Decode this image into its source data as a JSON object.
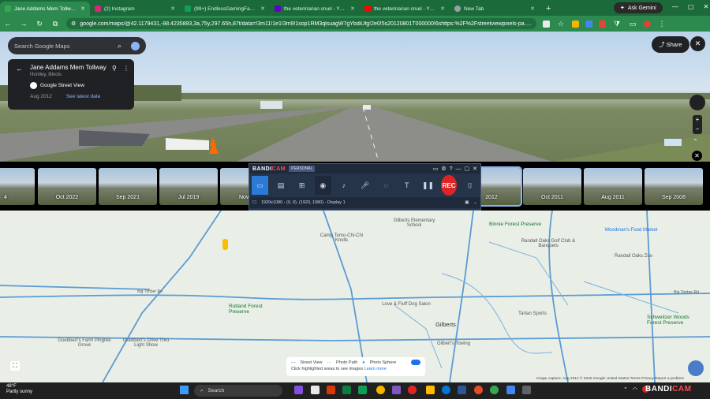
{
  "browser": {
    "tabs": [
      {
        "label": "Jane Addams Mem Tollway - G",
        "color": "#34a853",
        "active": true
      },
      {
        "label": "(2) Instagram",
        "color": "#d62976"
      },
      {
        "label": "(99+) EndlessGamingFanProdu",
        "color": "#0f9d58"
      },
      {
        "label": "the veterinarian cruel - Yahoo S",
        "color": "#6001d2"
      },
      {
        "label": "the veterinarian cruel - YouTub",
        "color": "#ff0000"
      },
      {
        "label": "New Tab",
        "color": "#9aa0a6"
      }
    ],
    "ask_gemini": "Ask Gemini",
    "url": "google.com/maps/@42.1179431,-88.4235893,3a,75y,297.65h,87t/data=!3m11!1e1!3m9!1sop1RM3qlsuagW7gYbdiUfg!2e0!5s20120801T000000!6shttps:%2F%2Fstreetviewpixels-pa.googleapis.com%2..."
  },
  "maps": {
    "search_placeholder": "Search Google Maps",
    "place_title": "Jane Addams Mem Tollway",
    "place_subtitle": "Huntley, Illinois",
    "source_label": "Google Street View",
    "capture_date": "Aug 2012",
    "latest_link": "See latest date",
    "share_label": "Share"
  },
  "timeline": [
    {
      "label": "4"
    },
    {
      "label": "Oct 2022"
    },
    {
      "label": "Sep 2021"
    },
    {
      "label": "Jul 2019"
    },
    {
      "label": "Nov 201"
    },
    {
      "label": "2012",
      "selected": true
    },
    {
      "label": "Oct 2011"
    },
    {
      "label": "Aug 2011"
    },
    {
      "label": "Sep 2008"
    }
  ],
  "bandicam": {
    "brand_a": "BANDI",
    "brand_b": "CAM",
    "edition": "PERSONAL",
    "rec_label": "REC",
    "status": "1920x1080 - (0, 0), (1920, 1080) - Display 1"
  },
  "map_labels": {
    "places": [
      "Camp Tomo-Chi-Chi Knolls",
      "Gilberts Elementary School",
      "Binnie Forest Preserve",
      "Randall Oaks Golf Club & Banquets",
      "Woodman's Food Market",
      "Randall Oaks Zoo",
      "Rutland Forest Preserve",
      "Love & Fluff Dog Salon",
      "Gilberts",
      "Gilbert's Towing",
      "Goebbert's Farm Pingree Grove",
      "Goebbert's Drive Thru Light Show",
      "Schweitzer Woods Forest Preserve",
      "Tartan Sports"
    ],
    "roads": [
      "Big Timber Rd",
      "Big Timber Rd"
    ]
  },
  "legend": {
    "street_view": "Street View",
    "photo_path": "Photo Path",
    "photo_sphere": "Photo Sphere",
    "hint": "Click highlighted areas to see images",
    "learn_more": "Learn more"
  },
  "attribution": "Image capture: Aug 2012   © 2025 Google   United States   Terms   Privacy   Report a problem",
  "taskbar": {
    "temp": "48°F",
    "condition": "Partly sunny",
    "search": "Search",
    "watermark_a": "BANDI",
    "watermark_b": "CAM"
  }
}
